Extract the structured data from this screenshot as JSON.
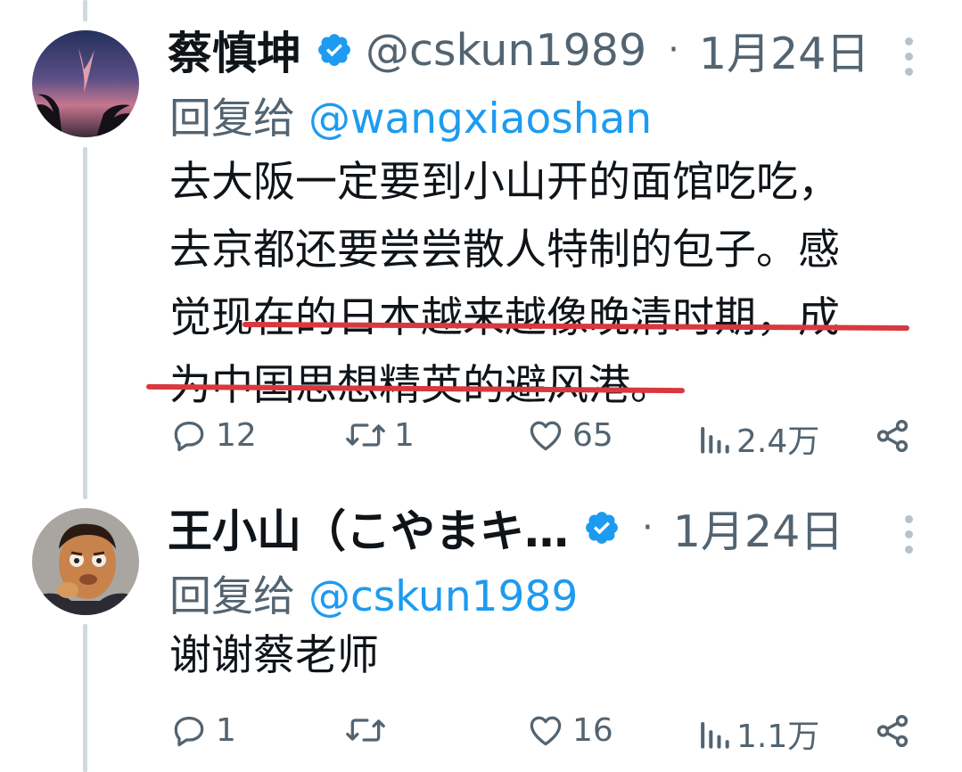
{
  "tweets": [
    {
      "name": "蔡慎坤",
      "handle": "@cskun1989",
      "separator": "·",
      "date": "1月24日",
      "reply_prefix": "回复给 ",
      "reply_to": "@wangxiaoshan",
      "lines": [
        "去大阪一定要到小山开的面馆吃吃，",
        "去京都还要尝尝散人特制的包子。感",
        "觉现在的日本越来越像晚清时期，成",
        "为中国思想精英的避风港。"
      ],
      "stats": {
        "replies": "12",
        "retweets": "1",
        "likes": "65",
        "views": "2.4万"
      }
    },
    {
      "name": "王小山（こやまキ…",
      "separator": "·",
      "date": "1月24日",
      "reply_prefix": "回复给 ",
      "reply_to": "@cskun1989",
      "lines": [
        "谢谢蔡老师"
      ],
      "stats": {
        "replies": "1",
        "retweets": "",
        "likes": "16",
        "views": "1.1万"
      }
    }
  ],
  "icons": {
    "verified": "verified-badge-icon",
    "more": "more-vertical-icon",
    "reply": "reply-bubble-icon",
    "retweet": "retweet-icon",
    "like": "heart-icon",
    "views": "views-bar-chart-icon",
    "share": "share-icon"
  },
  "colors": {
    "link": "#1d9bf0",
    "secondary_text": "#536471",
    "underline_annotation": "#d9383f",
    "thread_line": "#cfd9de"
  }
}
